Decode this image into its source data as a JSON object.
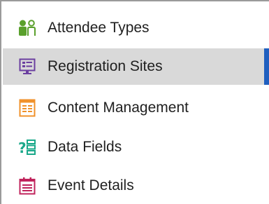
{
  "menu": {
    "items": [
      {
        "label": "Attendee Types",
        "icon": "attendees-icon",
        "selected": false
      },
      {
        "label": "Registration Sites",
        "icon": "registration-site-icon",
        "selected": true
      },
      {
        "label": "Content Management",
        "icon": "content-management-icon",
        "selected": false
      },
      {
        "label": "Data Fields",
        "icon": "data-fields-icon",
        "selected": false
      },
      {
        "label": "Event Details",
        "icon": "event-details-icon",
        "selected": false
      }
    ]
  },
  "colors": {
    "selected_background": "#d9d9d9",
    "selected_accent": "#1f5fbf",
    "attendees_icon": "#5aa02c",
    "registration_icon": "#6b3fa0",
    "content_icon": "#f0922b",
    "data_fields_icon": "#1aa88a",
    "event_details_icon": "#c0245c"
  }
}
